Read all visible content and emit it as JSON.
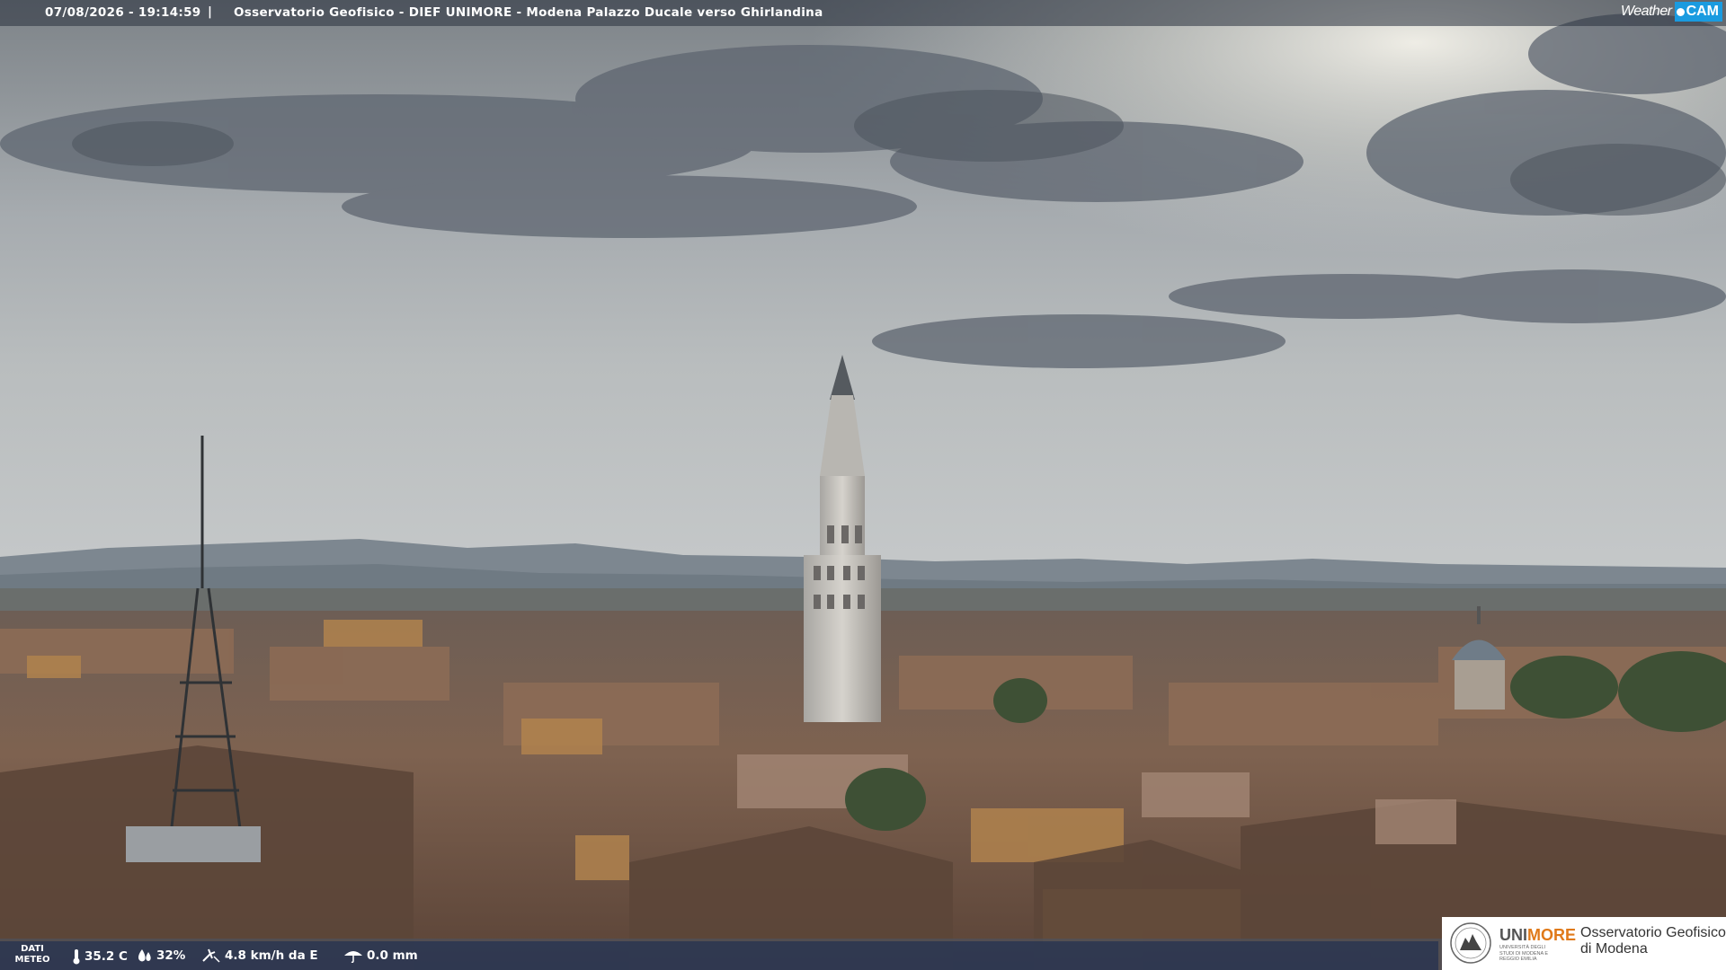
{
  "header": {
    "timestamp": "07/08/2026 - 19:14:59",
    "separator": "|",
    "title": "Osservatorio Geofisico - DIEF UNIMORE - Modena Palazzo Ducale verso Ghirlandina"
  },
  "brand": {
    "weather": "Weather",
    "cam": "CAM",
    "accent": "#1a9be0"
  },
  "weather_panel": {
    "label_line1": "DATI",
    "label_line2": "METEO",
    "temperature": "35.2 C",
    "humidity": "32%",
    "wind": "4.8 km/h da E",
    "rain": "0.0 mm"
  },
  "logo": {
    "uni": "UNI",
    "more": "MORE",
    "subline": "UNIVERSITÀ DEGLI STUDI DI MODENA E REGGIO EMILIA",
    "obs_line1": "Osservatorio Geofisico",
    "obs_line2": "di Modena",
    "accent": "#e07a1a"
  },
  "icons": [
    "thermometer-icon",
    "humidity-drop-icon",
    "wind-icon",
    "rain-icon"
  ]
}
